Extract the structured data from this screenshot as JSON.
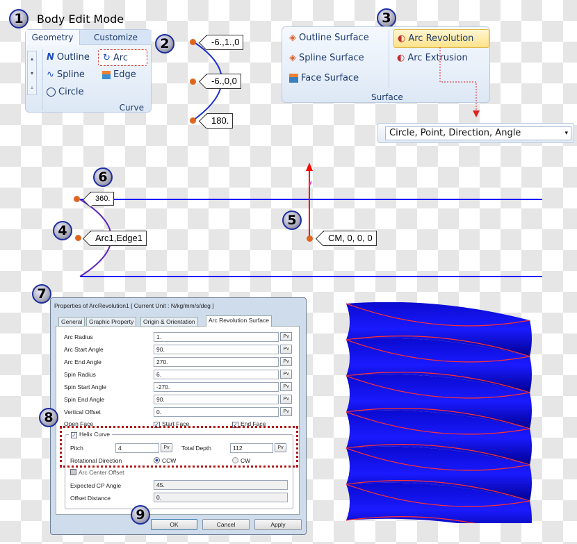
{
  "steps": [
    "1",
    "2",
    "3",
    "4",
    "5",
    "6",
    "7",
    "8",
    "9"
  ],
  "mode_title": "Body Edit Mode",
  "curve_ribbon": {
    "tabs": [
      "Geometry",
      "Customize"
    ],
    "items": [
      "Outline",
      "Arc",
      "Spline",
      "Edge",
      "Circle"
    ],
    "group_label": "Curve",
    "selected": "Arc"
  },
  "arc_points": [
    "-6.,1.,0",
    "-6.,0,0",
    "180."
  ],
  "surface_ribbon": {
    "items": [
      "Outline Surface",
      "Spline Surface",
      "Face Surface",
      "Arc Revolution",
      "Arc Extrusion"
    ],
    "group_label": "Surface",
    "selected": "Arc Revolution"
  },
  "method_dropdown": {
    "value": "Circle, Point, Direction, Angle"
  },
  "viewport": {
    "angle_label": "360.",
    "edge_label": "Arc1,Edge1",
    "cm_label": "CM, 0, 0, 0",
    "line_color": "#0000ff",
    "axis_color": "#ff0000"
  },
  "dialog": {
    "title": "Properties of ArcRevolution1 [ Current Unit : N/kg/mm/s/deg ]",
    "tabs": [
      "General",
      "Graphic Property",
      "Origin & Orientation",
      "Arc Revolution Surface"
    ],
    "active_tab": "Arc Revolution Surface",
    "fields": [
      {
        "label": "Arc Radius",
        "value": "1."
      },
      {
        "label": "Arc Start Angle",
        "value": "90."
      },
      {
        "label": "Arc End Angle",
        "value": "270."
      },
      {
        "label": "Spin Radius",
        "value": "6."
      },
      {
        "label": "Spin Start Angle",
        "value": "-270."
      },
      {
        "label": "Spin End Angle",
        "value": "90."
      },
      {
        "label": "Vertical Offset",
        "value": "0."
      }
    ],
    "pv": "Pv",
    "open_face": {
      "label": "Open Face",
      "start": "Start Face",
      "end": "End Face",
      "start_checked": true,
      "end_checked": true
    },
    "helix": {
      "label": "Helix Curve",
      "checked": true,
      "pitch_label": "Pitch",
      "pitch": "4",
      "depth_label": "Total Depth",
      "depth": "112",
      "dir_label": "Rotational Direction",
      "ccw": "CCW",
      "cw": "CW",
      "selected": "CCW"
    },
    "arc_center": {
      "label": "Arc Center Offset",
      "checked": false,
      "cp_label": "Expected CP Angle",
      "cp": "45.",
      "offset_label": "Offset Distance",
      "offset": "0."
    },
    "buttons": {
      "ok": "OK",
      "cancel": "Cancel",
      "apply": "Apply"
    }
  }
}
